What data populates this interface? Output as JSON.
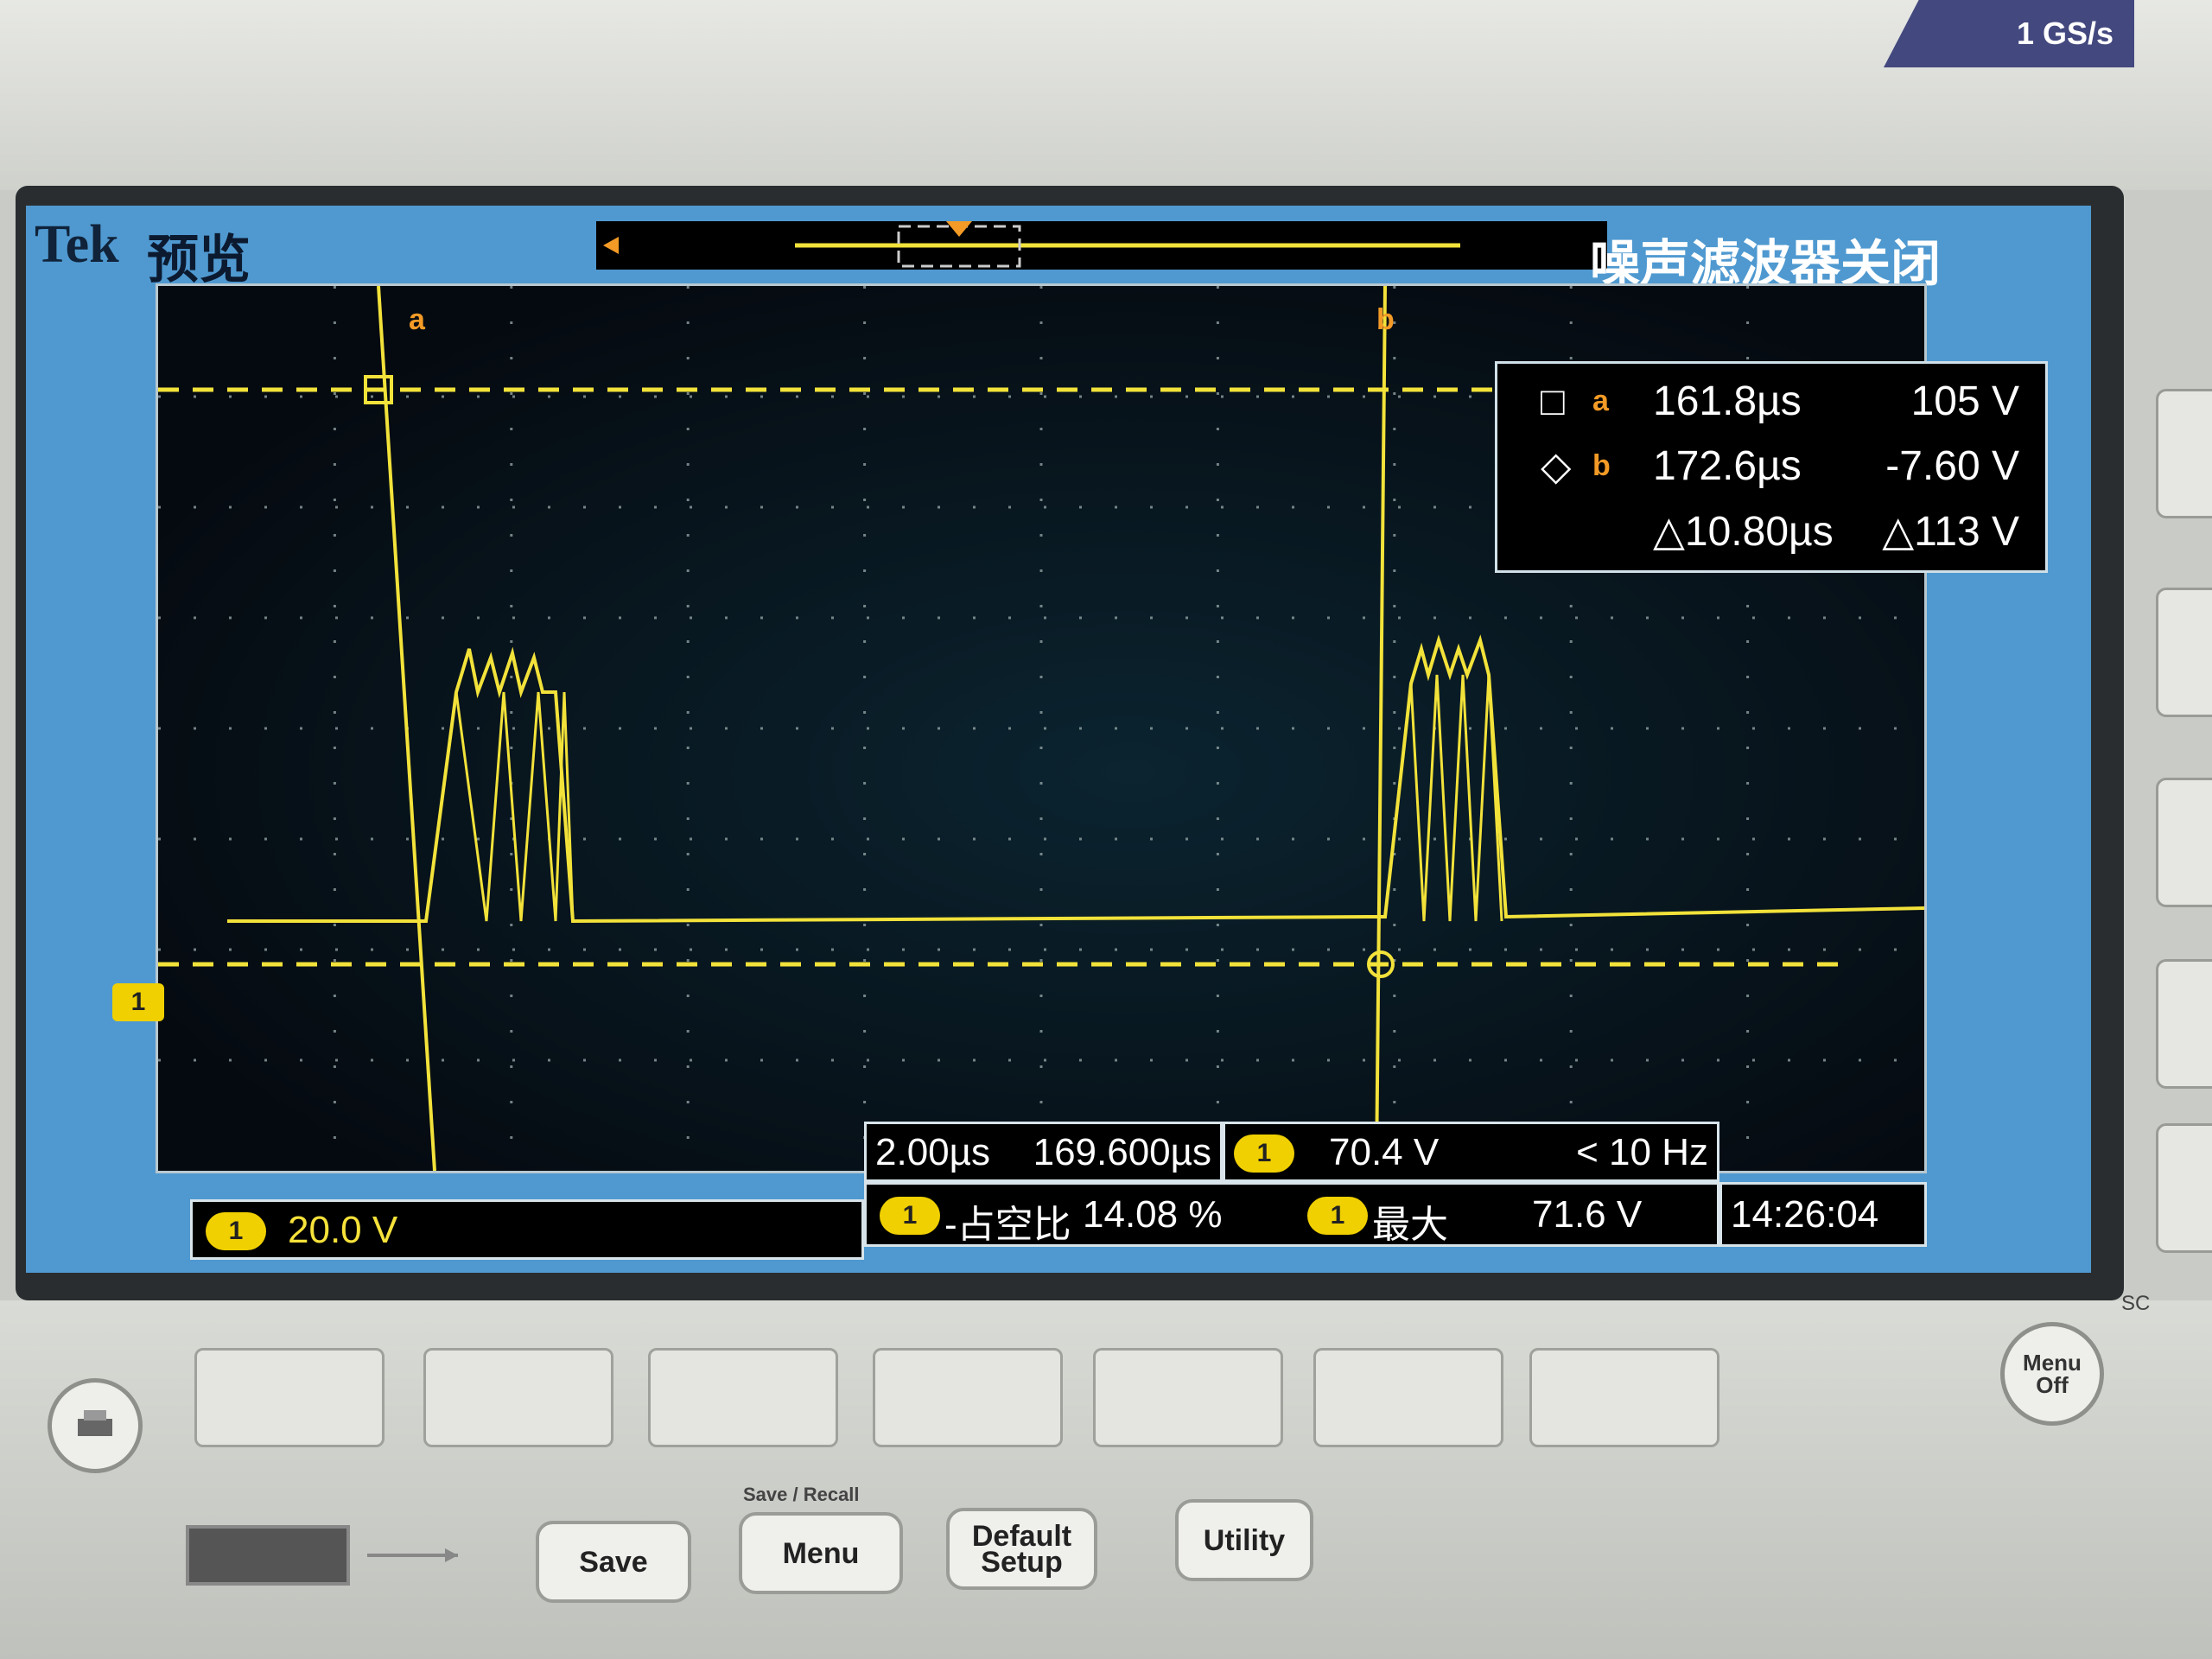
{
  "header": {
    "brand": "Tek",
    "mode": "预览",
    "sample_rate": "1 GS/s",
    "noise_filter": "噪声滤波器关闭"
  },
  "markers": {
    "cursor_a": "a",
    "cursor_b": "b",
    "channel": "1"
  },
  "cursor_readout": {
    "rows": [
      {
        "symbol": "□",
        "id": "a",
        "time": "161.8µs",
        "value": "105 V"
      },
      {
        "symbol": "◇",
        "id": "b",
        "time": "172.6µs",
        "value": "-7.60 V"
      },
      {
        "symbol": "",
        "id": "",
        "time": "△10.80µs",
        "value": "△113 V"
      }
    ]
  },
  "status": {
    "channel_scale": "20.0 V",
    "timebase": "2.00µs",
    "position": "169.600µs",
    "trigger_level": "70.4 V",
    "trigger_freq": "< 10 Hz",
    "duty_label": "-占空比",
    "duty_value": "14.08 %",
    "max_label": "最大",
    "max_value": "71.6 V",
    "clock": "14:26:04"
  },
  "buttons": {
    "group_label": "Save / Recall",
    "save": "Save",
    "menu": "Menu",
    "default_setup": "Default Setup",
    "utility": "Utility",
    "menu_off": "Menu Off",
    "sc": "SC"
  },
  "colors": {
    "trace": "#f2e23a",
    "marker": "#f39b26",
    "screen_bg": "#4f99d0"
  }
}
